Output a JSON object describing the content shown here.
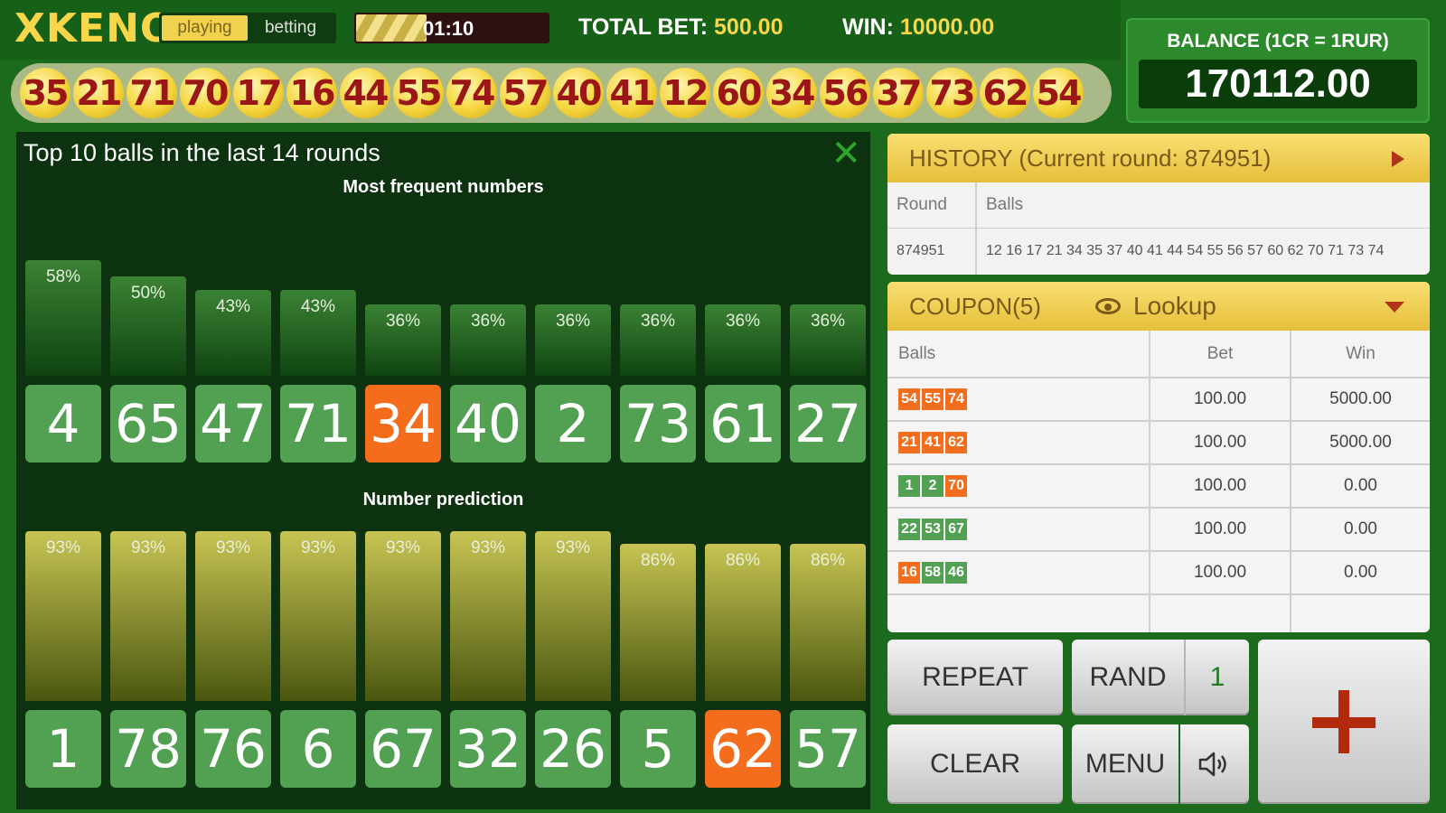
{
  "app": {
    "logo": "XKENO"
  },
  "header": {
    "modes": [
      "playing",
      "betting"
    ],
    "active_mode": "playing",
    "timer": "01:10",
    "total_bet_label": "TOTAL BET:",
    "total_bet_value": "500.00",
    "win_label": "WIN:",
    "win_value": "10000.00"
  },
  "drawn_balls": [
    "35",
    "21",
    "71",
    "70",
    "17",
    "16",
    "44",
    "55",
    "74",
    "57",
    "40",
    "41",
    "12",
    "60",
    "34",
    "56",
    "37",
    "73",
    "62",
    "54"
  ],
  "balance": {
    "label": "BALANCE (1CR = 1RUR)",
    "value": "170112.00"
  },
  "stats": {
    "title": "Top 10 balls in the last 14 rounds",
    "frequent_title": "Most frequent numbers",
    "prediction_title": "Number prediction",
    "frequent": [
      {
        "number": "4",
        "pct": "58%",
        "highlight": false
      },
      {
        "number": "65",
        "pct": "50%",
        "highlight": false
      },
      {
        "number": "47",
        "pct": "43%",
        "highlight": false
      },
      {
        "number": "71",
        "pct": "43%",
        "highlight": false
      },
      {
        "number": "34",
        "pct": "36%",
        "highlight": true
      },
      {
        "number": "40",
        "pct": "36%",
        "highlight": false
      },
      {
        "number": "2",
        "pct": "36%",
        "highlight": false
      },
      {
        "number": "73",
        "pct": "36%",
        "highlight": false
      },
      {
        "number": "61",
        "pct": "36%",
        "highlight": false
      },
      {
        "number": "27",
        "pct": "36%",
        "highlight": false
      }
    ],
    "prediction": [
      {
        "number": "1",
        "pct": "93%",
        "highlight": false
      },
      {
        "number": "78",
        "pct": "93%",
        "highlight": false
      },
      {
        "number": "76",
        "pct": "93%",
        "highlight": false
      },
      {
        "number": "6",
        "pct": "93%",
        "highlight": false
      },
      {
        "number": "67",
        "pct": "93%",
        "highlight": false
      },
      {
        "number": "32",
        "pct": "93%",
        "highlight": false
      },
      {
        "number": "26",
        "pct": "93%",
        "highlight": false
      },
      {
        "number": "5",
        "pct": "86%",
        "highlight": false
      },
      {
        "number": "62",
        "pct": "86%",
        "highlight": true
      },
      {
        "number": "57",
        "pct": "86%",
        "highlight": false
      }
    ]
  },
  "history": {
    "title": "HISTORY (Current round: 874951)",
    "col_round": "Round",
    "col_balls": "Balls",
    "rows": [
      {
        "round": "874951",
        "balls": "12 16 17 21 34 35 37 40 41 44 54 55 56 57 60 62 70 71 73 74"
      }
    ]
  },
  "coupon": {
    "title": "COUPON(5)",
    "lookup": "Lookup",
    "col_balls": "Balls",
    "col_bet": "Bet",
    "col_win": "Win",
    "rows": [
      {
        "balls": [
          {
            "n": "54",
            "c": "o"
          },
          {
            "n": "55",
            "c": "o"
          },
          {
            "n": "74",
            "c": "o"
          }
        ],
        "bet": "100.00",
        "win": "5000.00"
      },
      {
        "balls": [
          {
            "n": "21",
            "c": "o"
          },
          {
            "n": "41",
            "c": "o"
          },
          {
            "n": "62",
            "c": "o"
          }
        ],
        "bet": "100.00",
        "win": "5000.00"
      },
      {
        "balls": [
          {
            "n": "1",
            "c": "g"
          },
          {
            "n": "2",
            "c": "g"
          },
          {
            "n": "70",
            "c": "o"
          }
        ],
        "bet": "100.00",
        "win": "0.00"
      },
      {
        "balls": [
          {
            "n": "22",
            "c": "g"
          },
          {
            "n": "53",
            "c": "g"
          },
          {
            "n": "67",
            "c": "g"
          }
        ],
        "bet": "100.00",
        "win": "0.00"
      },
      {
        "balls": [
          {
            "n": "16",
            "c": "o"
          },
          {
            "n": "58",
            "c": "g"
          },
          {
            "n": "46",
            "c": "g"
          }
        ],
        "bet": "100.00",
        "win": "0.00"
      }
    ]
  },
  "controls": {
    "repeat": "REPEAT",
    "rand": "RAND",
    "rand_count": "1",
    "clear": "CLEAR",
    "menu": "MENU"
  },
  "colors": {
    "background": "#1c6a1c",
    "accent_gold": "#f7d64a",
    "highlight_orange": "#f36d1d",
    "ball_green": "#52a052",
    "plus_red": "#b02a0e"
  },
  "icons": {
    "close": "close-icon",
    "history_expand": "triangle-right-icon",
    "coupon_expand": "triangle-down-icon",
    "lookup": "eye-icon",
    "sound": "speaker-icon",
    "add": "plus-icon"
  }
}
